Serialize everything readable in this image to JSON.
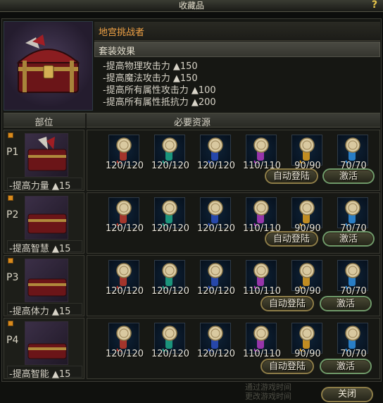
{
  "window": {
    "title": "收藏品",
    "help": "?"
  },
  "set": {
    "name": "地宫挑战者",
    "effect_header": "套装效果",
    "effects": [
      "-提高物理攻击力 ▲150",
      "-提高魔法攻击力 ▲150",
      "-提高所有属性攻击力 ▲100",
      "-提高所有属性抵抗力 ▲200"
    ]
  },
  "table": {
    "col_part": "部位",
    "col_resources": "必要资源"
  },
  "rows": [
    {
      "label": "P1",
      "bonus": "-提高力量 ▲15",
      "resources": [
        "120/120",
        "120/120",
        "120/120",
        "110/110",
        "90/90",
        "70/70"
      ],
      "auto_label": "自动登陆",
      "activate_label": "激活"
    },
    {
      "label": "P2",
      "bonus": "-提高智慧 ▲15",
      "resources": [
        "120/120",
        "120/120",
        "120/120",
        "110/110",
        "90/90",
        "70/70"
      ],
      "auto_label": "自动登陆",
      "activate_label": "激活"
    },
    {
      "label": "P3",
      "bonus": "-提高体力 ▲15",
      "resources": [
        "120/120",
        "120/120",
        "120/120",
        "110/110",
        "90/90",
        "70/70"
      ],
      "auto_label": "自动登陆",
      "activate_label": "激活"
    },
    {
      "label": "P4",
      "bonus": "-提高智能 ▲15",
      "resources": [
        "120/120",
        "120/120",
        "120/120",
        "110/110",
        "90/90",
        "70/70"
      ],
      "auto_label": "自动登陆",
      "activate_label": "激活"
    }
  ],
  "resource_icons": [
    "scroll-red-icon",
    "scroll-green-icon",
    "scroll-blue-icon",
    "scroll-purple-icon",
    "scroll-gold-icon",
    "scroll-sky-icon"
  ],
  "resource_colors": [
    "#c0392b",
    "#1fa98a",
    "#2b4fbf",
    "#b03abf",
    "#e0a020",
    "#2f8fe0"
  ],
  "footer": {
    "hint_line1": "通过游戏时间",
    "hint_line2": "更改游戏时间",
    "close_label": "关闭"
  }
}
